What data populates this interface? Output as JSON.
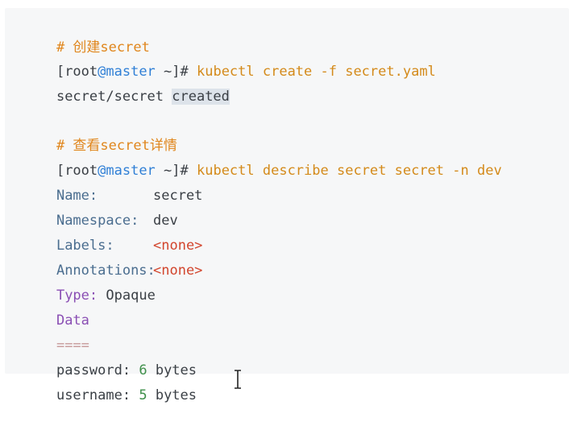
{
  "colors": {
    "panel_bg": "#f6f7f8",
    "comment": "#e0861c",
    "command": "#d48a1a",
    "host": "#2f7fd6",
    "key": "#4a6d8f",
    "value_red": "#d2452d",
    "purple": "#8a4fb4",
    "green": "#3e8f4a"
  },
  "terminal": {
    "comment_create": "# 创建secret",
    "prompt_open": "[root",
    "prompt_host": "@master",
    "prompt_close": " ~]# ",
    "cmd_create": "kubectl create -f secret.yaml",
    "result_prefix": "secret/secret ",
    "result_highlight": "created",
    "comment_describe": "# 查看secret详情",
    "cmd_describe": "kubectl describe secret secret -n dev",
    "name_key": "Name:",
    "name_val": "secret",
    "namespace_key": "Namespace:",
    "namespace_val": "dev",
    "labels_key": "Labels:",
    "labels_val": "<none>",
    "annotations_key": "Annotations:",
    "annotations_val": "<none>",
    "type_key": "Type:",
    "type_val": "Opaque",
    "data_heading": "Data",
    "separator": "====",
    "password_key": "password:",
    "password_num": "6",
    "password_unit": "bytes",
    "username_key": "username:",
    "username_num": "5",
    "username_unit": "bytes"
  },
  "cursor": {
    "icon": "text-cursor-icon"
  }
}
